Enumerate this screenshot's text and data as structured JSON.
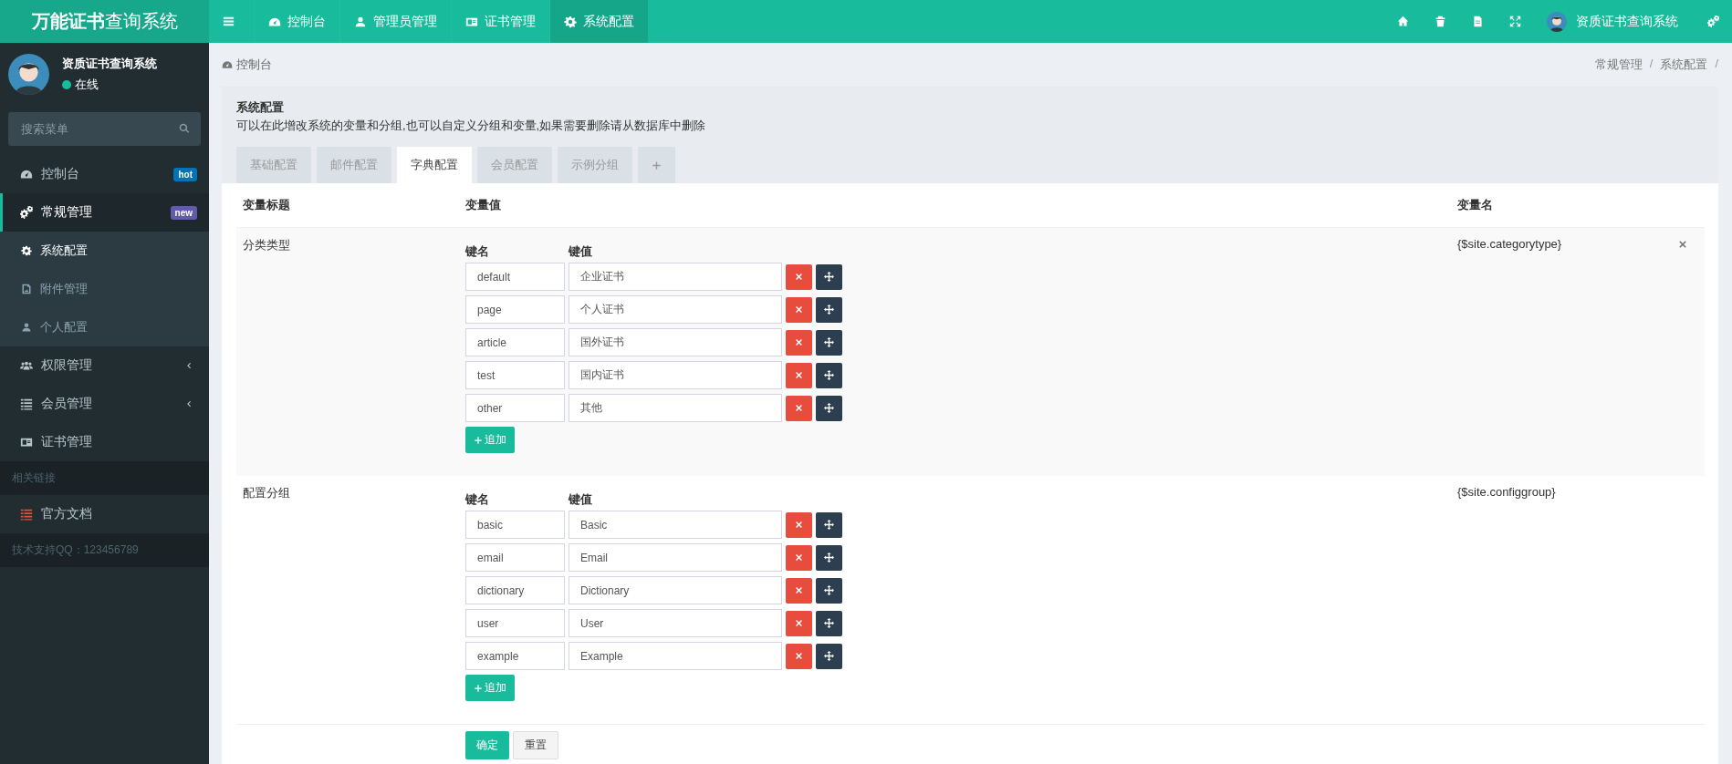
{
  "header": {
    "logo_bold": "万能证书",
    "logo_light": "查询系统",
    "nav": [
      {
        "label": "控制台",
        "selected": false
      },
      {
        "label": "管理员管理",
        "selected": false
      },
      {
        "label": "证书管理",
        "selected": false
      },
      {
        "label": "系统配置",
        "selected": true
      }
    ],
    "user_name": "资质证书查询系统"
  },
  "sidebar": {
    "user": {
      "name": "资质证书查询系统",
      "status": "在线"
    },
    "search": {
      "placeholder": "搜索菜单"
    },
    "menu": [
      {
        "kind": "item",
        "label": "控制台",
        "selected": false,
        "badge": {
          "text": "hot",
          "color": "#0073b7"
        }
      },
      {
        "kind": "item",
        "label": "常规管理",
        "selected": true,
        "badge": {
          "text": "new",
          "color": "#605ca8"
        },
        "children": [
          {
            "label": "系统配置",
            "selected": true
          },
          {
            "label": "附件管理",
            "selected": false
          },
          {
            "label": "个人配置",
            "selected": false
          }
        ]
      },
      {
        "kind": "item",
        "label": "权限管理",
        "selected": false,
        "expanded": false
      },
      {
        "kind": "item",
        "label": "会员管理",
        "selected": false,
        "expanded": false
      },
      {
        "kind": "item",
        "label": "证书管理",
        "selected": false
      },
      {
        "kind": "section",
        "label": "相关链接"
      },
      {
        "kind": "link",
        "label": "官方文档"
      },
      {
        "kind": "footer",
        "label": "技术支持QQ：123456789"
      }
    ]
  },
  "breadcrumb": {
    "page": "控制台",
    "trail": [
      "常规管理",
      "系统配置"
    ],
    "separator": "/"
  },
  "panel": {
    "title": "系统配置",
    "description": "可以在此增改系统的变量和分组,也可以自定义分组和变量,如果需要删除请从数据库中删除",
    "tabs": [
      {
        "label": "基础配置",
        "selected": false
      },
      {
        "label": "邮件配置",
        "selected": false
      },
      {
        "label": "字典配置",
        "selected": true
      },
      {
        "label": "会员配置",
        "selected": false
      },
      {
        "label": "示例分组",
        "selected": false
      }
    ],
    "table": {
      "columns": [
        "变量标题",
        "变量值",
        "变量名"
      ],
      "rows": [
        {
          "title": "分类类型",
          "key_header": "键名",
          "value_header": "键值",
          "var_name": "{$site.categorytype}",
          "removable": true,
          "add_label": "追加",
          "pairs": [
            {
              "key": "default",
              "value": "企业证书"
            },
            {
              "key": "page",
              "value": "个人证书"
            },
            {
              "key": "article",
              "value": "国外证书"
            },
            {
              "key": "test",
              "value": "国内证书"
            },
            {
              "key": "other",
              "value": "其他"
            }
          ]
        },
        {
          "title": "配置分组",
          "key_header": "键名",
          "value_header": "键值",
          "var_name": "{$site.configgroup}",
          "add_label": "追加",
          "pairs": [
            {
              "key": "basic",
              "value": "Basic"
            },
            {
              "key": "email",
              "value": "Email"
            },
            {
              "key": "dictionary",
              "value": "Dictionary"
            },
            {
              "key": "user",
              "value": "User"
            },
            {
              "key": "example",
              "value": "Example"
            }
          ]
        }
      ]
    },
    "buttons": [
      "确定",
      "重置"
    ]
  }
}
